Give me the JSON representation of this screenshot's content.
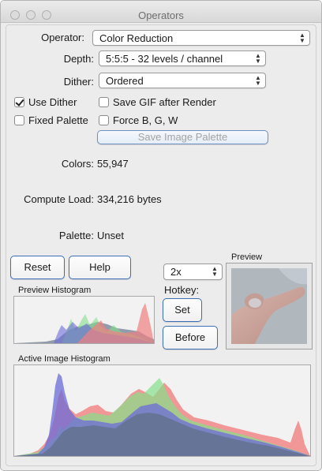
{
  "window": {
    "title": "Operators"
  },
  "operator": {
    "label": "Operator:",
    "value": "Color Reduction"
  },
  "depth": {
    "label": "Depth:",
    "value": "5:5:5 -  32 levels / channel"
  },
  "dither": {
    "label": "Dither:",
    "value": "Ordered"
  },
  "options": {
    "use_dither": {
      "label": "Use Dither",
      "checked": true
    },
    "save_gif": {
      "label": "Save GIF after Render",
      "checked": false
    },
    "fixed_palette": {
      "label": "Fixed Palette",
      "checked": false
    },
    "force_bgw": {
      "label": "Force B, G, W",
      "checked": false
    }
  },
  "save_palette_button": "Save Image Palette",
  "stats": {
    "colors_label": "Colors:",
    "colors_value": "55,947",
    "load_label": "Compute Load:",
    "load_value": "334,216 bytes",
    "palette_label": "Palette:",
    "palette_value": "Unset"
  },
  "buttons": {
    "reset": "Reset",
    "help": "Help",
    "set": "Set",
    "before": "Before"
  },
  "zoom": {
    "value": "2x"
  },
  "hotkey_label": "Hotkey:",
  "preview_label": "Preview",
  "preview_histogram_label": "Preview Histogram",
  "active_histogram_label": "Active Image Histogram",
  "colors": {
    "red": "#f08080",
    "green": "#86e08a",
    "blue": "#6b6bd8",
    "gray": "#5c6b80",
    "accent": "#3b6fb6"
  }
}
